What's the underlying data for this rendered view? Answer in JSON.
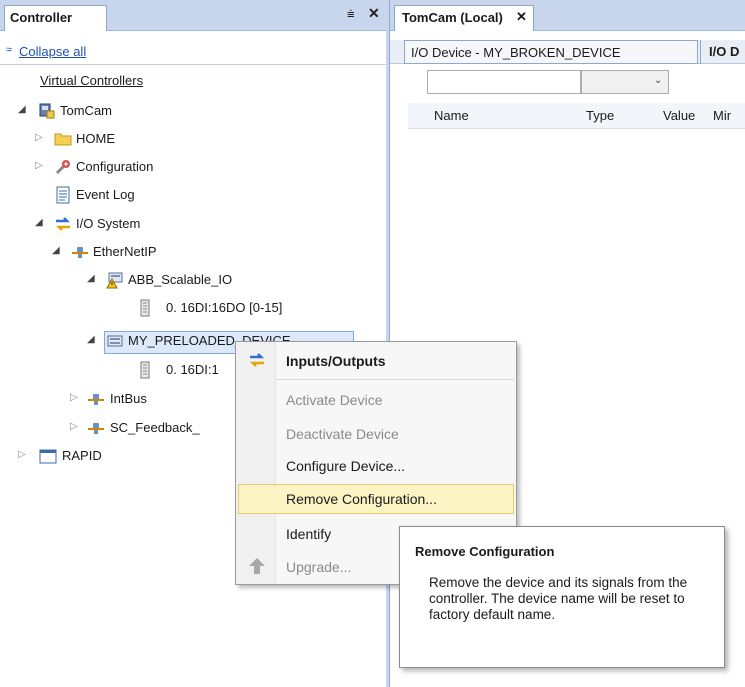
{
  "controller_pane": {
    "tab_label": "Controller",
    "pin_glyph": "⩧",
    "close_glyph": "✕",
    "collapse_glyph": "≈",
    "collapse_all": "Collapse all",
    "root_label": "Virtual Controllers"
  },
  "tree": {
    "controller": "TomCam",
    "home": "HOME",
    "configuration": "Configuration",
    "event_log": "Event Log",
    "io_system": "I/O System",
    "ethernetip": "EtherNetIP",
    "abb_scalable": "ABB_Scalable_IO",
    "abb_module": "0. 16DI:16DO  [0-15]",
    "my_device": "MY_PRELOADED_DEVICE",
    "my_module": "0. 16DI:1",
    "intbus": "IntBus",
    "sc_feedback": "SC_Feedback_",
    "rapid": "RAPID"
  },
  "document": {
    "tab_label": "TomCam (Local)",
    "tab_close": "✕",
    "subtab_label": "I/O Device - MY_BROKEN_DEVICE",
    "subtab2_label": "I/O D",
    "filter_chevron": "⌄",
    "columns": [
      "Name",
      "Type",
      "Value",
      "Mir"
    ]
  },
  "context_menu": {
    "items": [
      {
        "label": "Inputs/Outputs",
        "state": "bold"
      },
      {
        "label": "Activate Device",
        "state": "disabled"
      },
      {
        "label": "Deactivate Device",
        "state": "disabled"
      },
      {
        "label": "Configure Device...",
        "state": "enabled"
      },
      {
        "label": "Remove Configuration...",
        "state": "highlighted"
      },
      {
        "label": "Identify",
        "state": "enabled"
      },
      {
        "label": "Upgrade...",
        "state": "disabled"
      }
    ]
  },
  "tooltip": {
    "title": "Remove Configuration",
    "body": "Remove the device and its signals from the controller. The device name will be reset to factory default name."
  },
  "colors": {
    "header_bg": "#c7d6ed",
    "link": "#1f4fb4",
    "menu_highlight": "#fcf4c5",
    "selection": "#dce9fb"
  }
}
